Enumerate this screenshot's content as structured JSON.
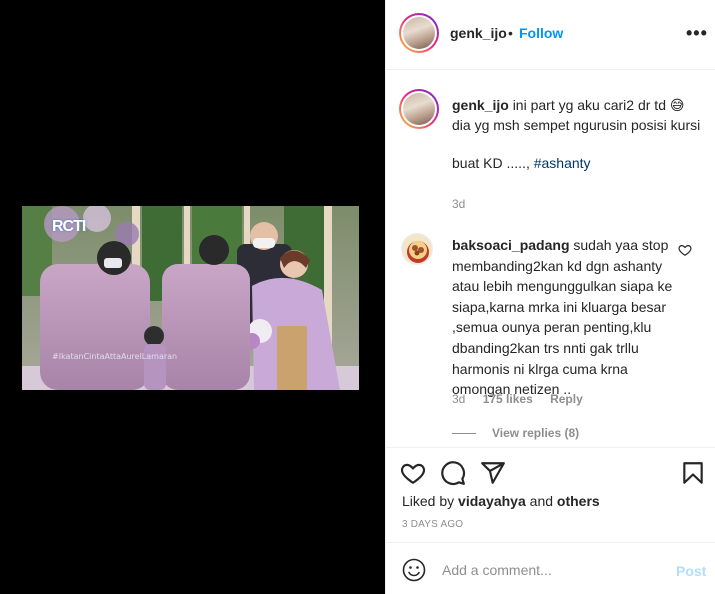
{
  "header": {
    "username": "genk_ijo",
    "dot": "•",
    "follow_label": "Follow",
    "more_label": "•••"
  },
  "media": {
    "logo": "RCTI",
    "watermark": "#IkatanCintaAttaAurelLamaran"
  },
  "caption": {
    "username": "genk_ijo",
    "text": "ini part yg aku cari2 dr td 😅 dia yg msh sempet ngurusin posisi kursi",
    "text2": "buat KD .....",
    "hashtag": "#ashanty",
    "time": "3d"
  },
  "comment": {
    "username": "baksoaci_padang",
    "text": "sudah yaa stop membanding2kan kd dgn ashanty atau lebih mengunggulkan siapa ke siapa,karna mrka ini kluarga besar ,semua ounya peran penting,klu dbanding2kan trs nnti gak trllu harmonis ni klrga cuma krna omongan netizen ..",
    "time": "3d",
    "likes": "175 likes",
    "reply_label": "Reply",
    "view_replies": "View replies (8)"
  },
  "actions": {
    "liked_prefix": "Liked by",
    "liked_user": "vidayahya",
    "liked_and": "and",
    "liked_others": "others",
    "time_ago": "3 DAYS AGO",
    "icons": [
      "heart-icon",
      "comment-icon",
      "share-icon",
      "bookmark-icon"
    ]
  },
  "add_comment": {
    "placeholder": "Add a comment...",
    "post_label": "Post"
  },
  "colors": {
    "accent": "#0095f6",
    "muted": "#8e8e8e",
    "post_disabled": "#b2dffc",
    "text": "#262626"
  }
}
